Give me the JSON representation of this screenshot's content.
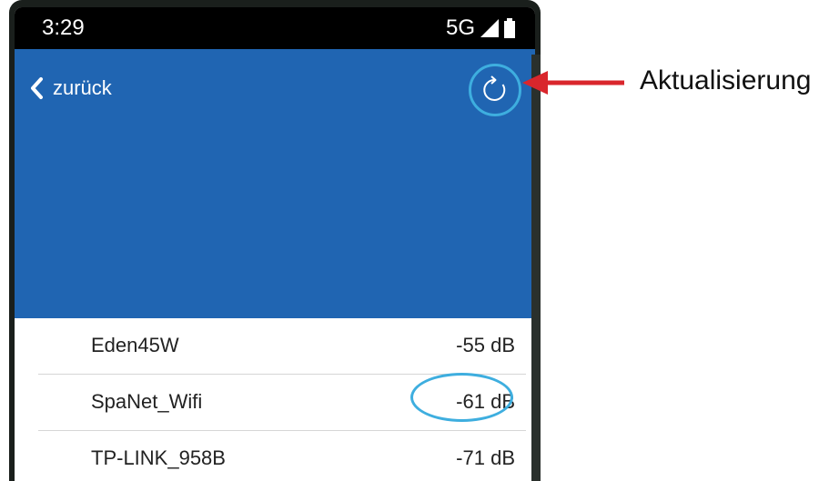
{
  "status_bar": {
    "time": "3:29",
    "network": "5G"
  },
  "header": {
    "back_label": "zurück",
    "refresh_icon": "refresh-icon"
  },
  "networks": [
    {
      "name": "Eden45W",
      "signal": "-55 dB"
    },
    {
      "name": "SpaNet_Wifi",
      "signal": "-61 dB"
    },
    {
      "name": "TP-LINK_958B",
      "signal": "-71 dB"
    }
  ],
  "annotation": {
    "label": "Aktualisierung"
  },
  "colors": {
    "header": "#2065b2",
    "highlight": "#3eaedf",
    "arrow": "#d9262c"
  }
}
